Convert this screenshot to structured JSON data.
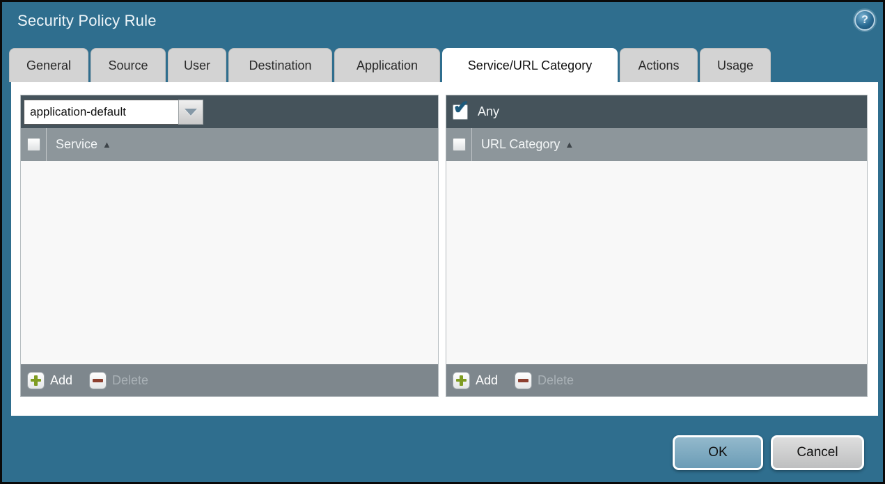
{
  "dialog": {
    "title": "Security Policy Rule",
    "help_glyph": "?",
    "tabs": [
      {
        "label": "General",
        "active": false
      },
      {
        "label": "Source",
        "active": false
      },
      {
        "label": "User",
        "active": false
      },
      {
        "label": "Destination",
        "active": false
      },
      {
        "label": "Application",
        "active": false
      },
      {
        "label": "Service/URL Category",
        "active": true
      },
      {
        "label": "Actions",
        "active": false
      },
      {
        "label": "Usage",
        "active": false
      }
    ],
    "service_panel": {
      "dropdown_value": "application-default",
      "column_header": "Service",
      "sort_arrow": "▲",
      "checkbox_checked": false,
      "add_label": "Add",
      "delete_label": "Delete",
      "delete_enabled": false,
      "rows": []
    },
    "url_category_panel": {
      "any_label": "Any",
      "any_checked": true,
      "check_glyph": "✔",
      "column_header": "URL Category",
      "sort_arrow": "▲",
      "checkbox_checked": false,
      "add_label": "Add",
      "delete_label": "Delete",
      "delete_enabled": false,
      "rows": []
    },
    "footer": {
      "ok_label": "OK",
      "cancel_label": "Cancel"
    },
    "colors": {
      "background_teal": "#2f6e8e",
      "toolbar_dark": "#45535b",
      "header_gray": "#8d969b",
      "footer_gray": "#7e878d",
      "tab_inactive": "#d3d3d3",
      "tab_active": "#ffffff",
      "ok_button": "#6b9cb6",
      "cancel_button": "#bebfc0",
      "add_plus_green": "#7f9c22",
      "delete_minus_red": "#8d4030",
      "checkmark_blue": "#1d5a7c"
    }
  }
}
